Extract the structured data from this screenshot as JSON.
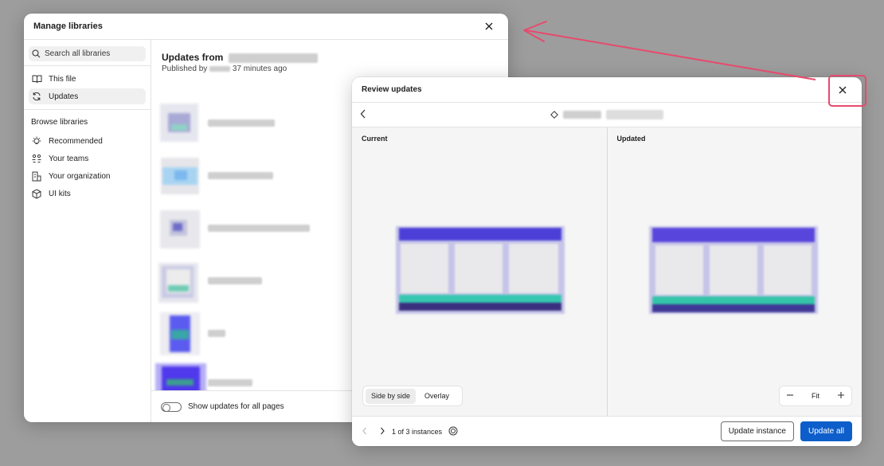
{
  "manage": {
    "title": "Manage libraries",
    "search_placeholder": "Search all libraries",
    "nav": [
      {
        "label": "This file",
        "icon": "book-icon"
      },
      {
        "label": "Updates",
        "icon": "refresh-icon",
        "active": true
      }
    ],
    "browse_label": "Browse libraries",
    "browse": [
      {
        "label": "Recommended",
        "icon": "lightbulb-icon"
      },
      {
        "label": "Your teams",
        "icon": "team-icon"
      },
      {
        "label": "Your organization",
        "icon": "organization-icon"
      },
      {
        "label": "UI kits",
        "icon": "kit-icon"
      }
    ],
    "updates_title": "Updates from",
    "published_prefix": "Published by",
    "published_suffix": "37 minutes ago",
    "show_all_label": "Show updates for all pages"
  },
  "review": {
    "title": "Review updates",
    "current_label": "Current",
    "updated_label": "Updated",
    "view_modes": [
      "Side by side",
      "Overlay"
    ],
    "zoom_label": "Fit",
    "instances_text": "1 of 3 instances",
    "update_instance_label": "Update instance",
    "update_all_label": "Update all"
  },
  "colors": {
    "primary": "#0d5ecb",
    "annotation": "#e74a6d",
    "backdrop": "#9d9d9d"
  }
}
